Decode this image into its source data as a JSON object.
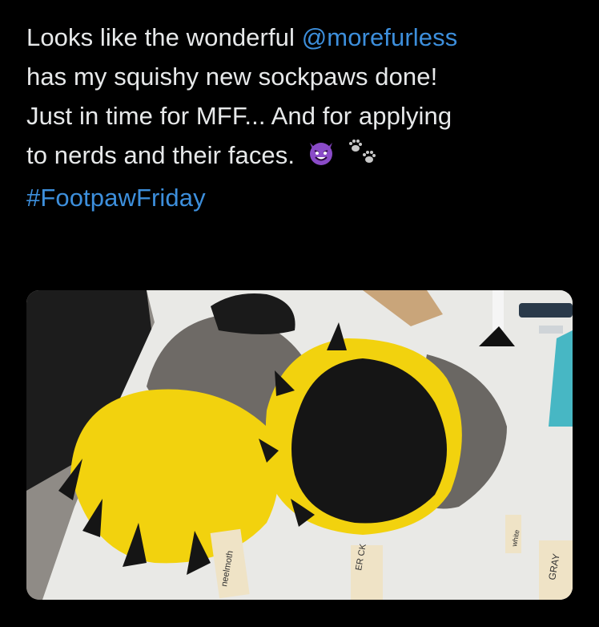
{
  "tweet": {
    "line1_text": "Looks like the wonderful ",
    "mention": "@morefurless",
    "line2": "has my squishy new sockpaws done!",
    "line3": "Just in time for MFF... And for applying",
    "line4_text": "to nerds and their faces.",
    "emoji_1": "smiling-imp-emoji",
    "emoji_2": "paw-prints-emoji",
    "hashtag": "#FootpawFriday"
  },
  "photo": {
    "tag_1": "neelmoth",
    "tag_2": "ER CK",
    "tag_3": "white",
    "tag_4": "GRAY",
    "colors": {
      "fur_yellow": "#f2d20e",
      "pad_black": "#151515",
      "fur_gray": "#6e6a66",
      "table_white": "#e9e9e6",
      "accent_teal": "#47b7c4"
    }
  }
}
